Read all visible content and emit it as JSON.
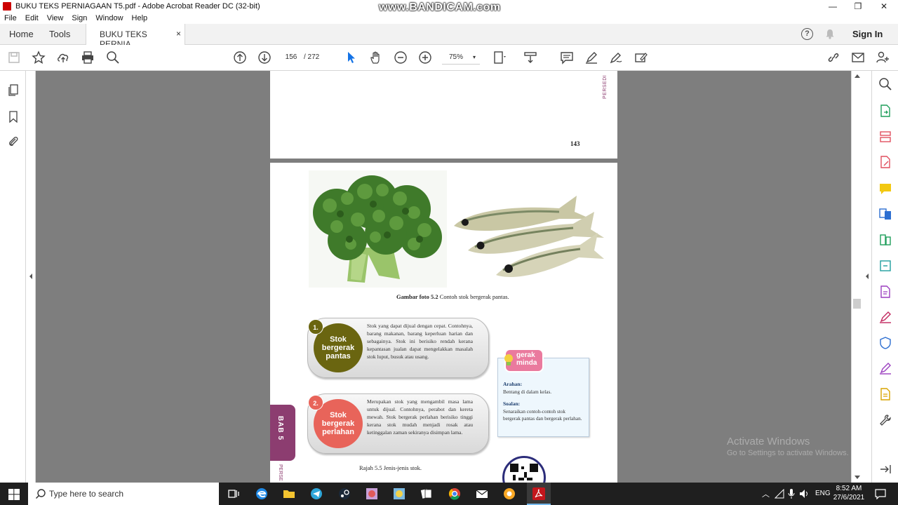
{
  "window": {
    "title": "BUKU TEKS PERNIAGAAN T5.pdf - Adobe Acrobat Reader DC (32-bit)",
    "watermark": "www.BANDICAM.com",
    "minimize": "—",
    "maximize": "❐",
    "close": "✕"
  },
  "menu": [
    "File",
    "Edit",
    "View",
    "Sign",
    "Window",
    "Help"
  ],
  "tabs": {
    "home": "Home",
    "tools": "Tools",
    "document": "BUKU TEKS PERNIA...",
    "close": "×",
    "help": "?",
    "signin": "Sign In"
  },
  "toolbar": {
    "current_page": "156",
    "page_separator": "/  272",
    "zoom": "75%",
    "zoom_caret": "▾"
  },
  "document": {
    "top_page_number": "143",
    "top_side_tag": "PERSEDI",
    "caption_photo_label": "Gambar foto 5.2",
    "caption_photo_text": "Contoh stok bergerak pantas.",
    "cards": [
      {
        "number": "1.",
        "title": "Stok bergerak pantas",
        "color": "#6a6510",
        "description": "Stok yang dapat dijual dengan cepat. Contohnya, barang makanan, barang keperluan harian dan sebagainya. Stok ini berisiko rendah kerana kepantasan jualan dapat mengelakkan masalah stok luput, busuk atau usang."
      },
      {
        "number": "2.",
        "title": "Stok bergerak perlahan",
        "color": "#e8645a",
        "description": "Merupakan stok yang mengambil masa lama untuk dijual. Contohnya, perabot dan kereta mewah. Stok bergerak perlahan berisiko tinggi kerana stok mudah menjadi rosak atau ketinggalan zaman sekiranya disimpan lama."
      }
    ],
    "chapter_tab": "BAB 5",
    "bottom_side_tag": "PERSE",
    "caption_diagram": "Rajah 5.5 Jenis-jenis stok.",
    "gerak_minda": {
      "badge": "gerak minda",
      "arahan_label": "Arahan:",
      "arahan_text": "Bentang di dalam kelas.",
      "soalan_label": "Soalan:",
      "soalan_text": "Senaraikan contoh-contoh stok bergerak pantas dan bergerak perlahan."
    }
  },
  "activation": {
    "title": "Activate Windows",
    "subtitle": "Go to Settings to activate Windows."
  },
  "taskbar": {
    "search_placeholder": "Type here to search",
    "language": "ENG",
    "time": "8:52 AM",
    "date": "27/6/2021"
  }
}
